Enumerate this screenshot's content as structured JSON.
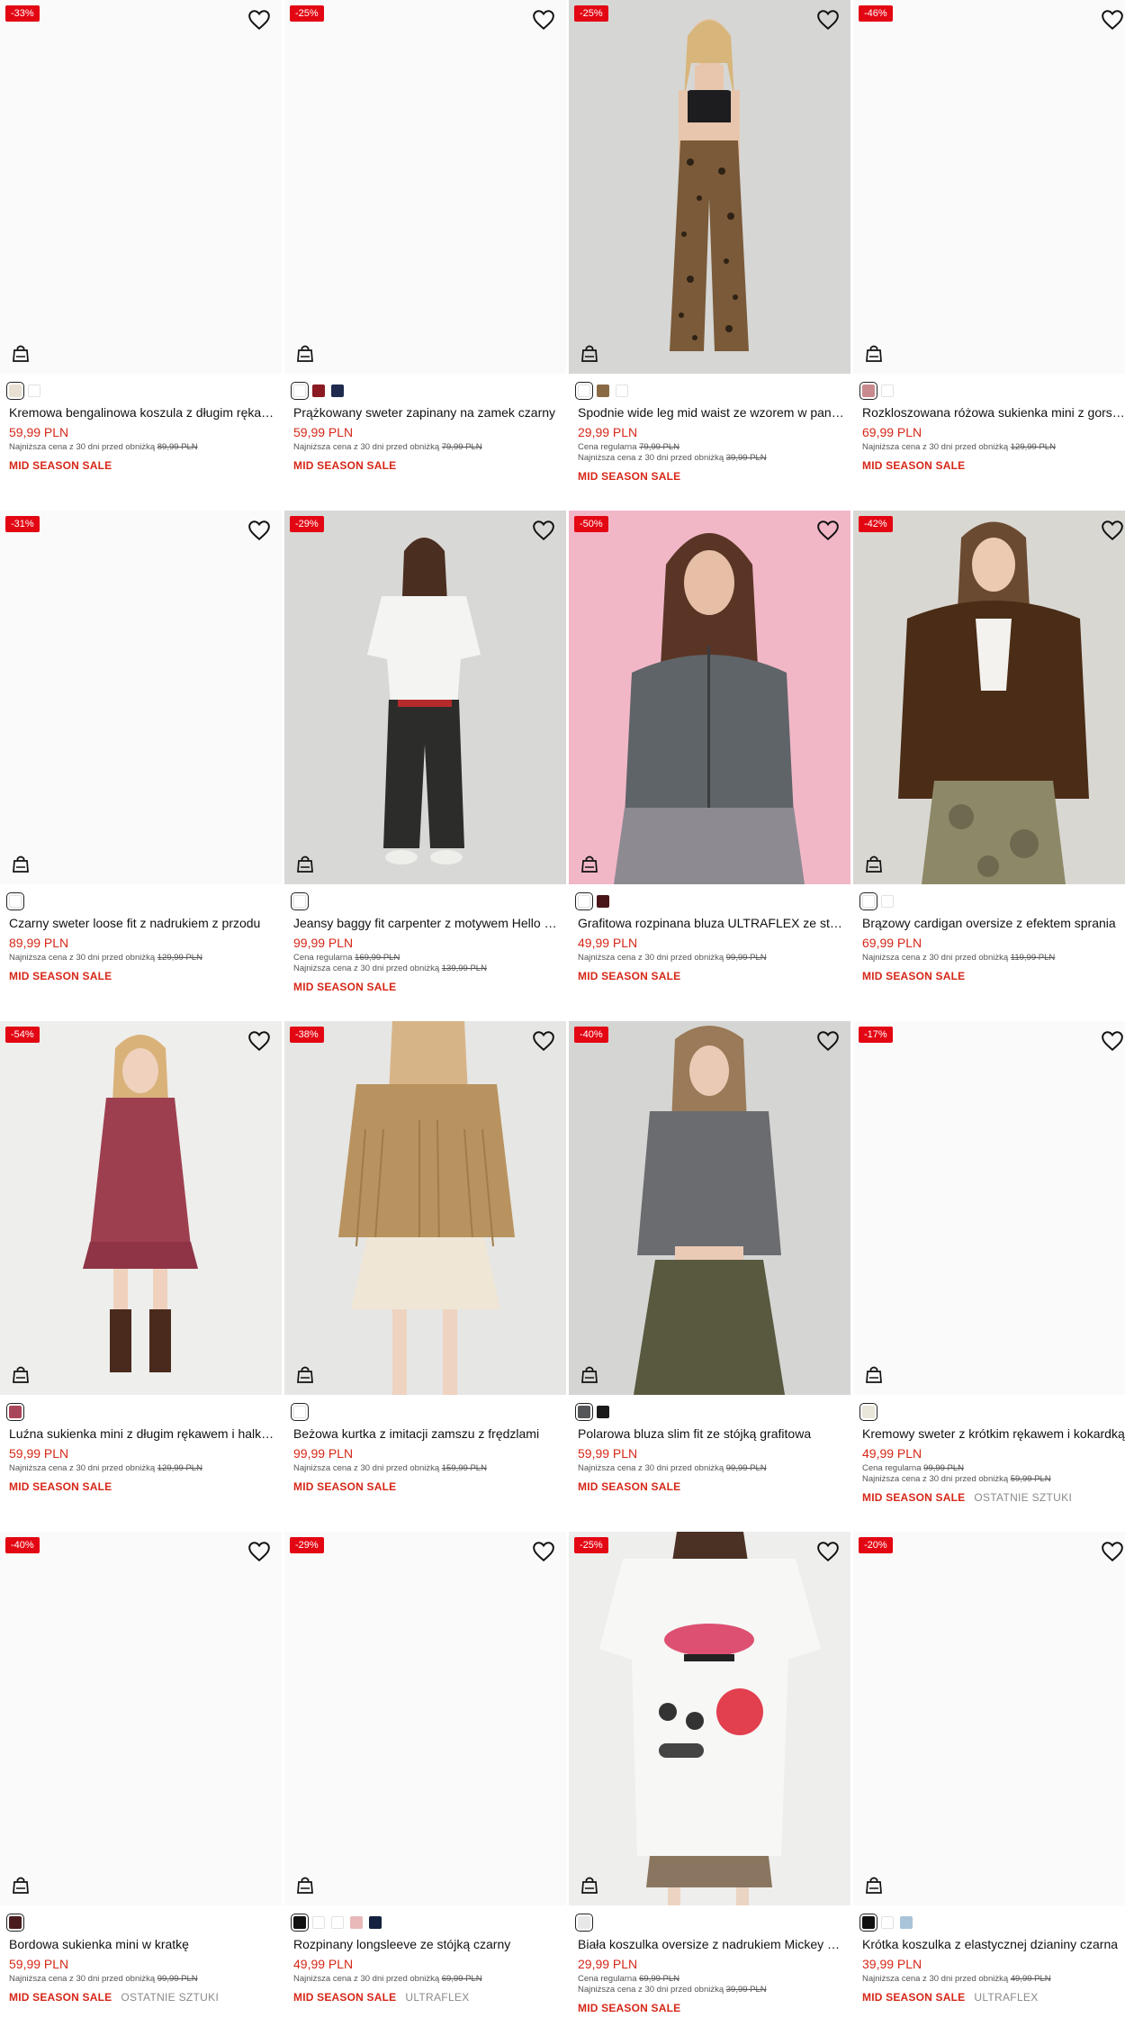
{
  "icons": {
    "wishlist": "heart-icon",
    "cart": "shopping-bag-icon"
  },
  "colors": {
    "discount_badge": "#e30613",
    "price": "#d62718",
    "sale_label": "#d62718"
  },
  "products": [
    {
      "discount": "-33%",
      "name": "Kremowa bengalinowa koszula z długim rękawem i kieszonkami",
      "price": "59,99 PLN",
      "regular_label": "",
      "regular_price": "",
      "lowest_label": "Najniższa cena z 30 dni przed obniżką",
      "lowest_price": "89,99 PLN",
      "sale": "MID SEASON SALE",
      "tag": "",
      "swatches": [
        "#e8e1d3",
        "#ffffff"
      ],
      "photo": "none"
    },
    {
      "discount": "-25%",
      "name": "Prążkowany sweter zapinany na zamek czarny",
      "price": "59,99 PLN",
      "regular_label": "",
      "regular_price": "",
      "lowest_label": "Najniższa cena z 30 dni przed obniżką",
      "lowest_price": "79,99 PLN",
      "sale": "MID SEASON SALE",
      "tag": "",
      "swatches": [
        "#ffffff",
        "#8b1a22",
        "#1f2a4e"
      ],
      "photo": "none"
    },
    {
      "discount": "-25%",
      "name": "Spodnie wide leg mid waist ze wzorem w panterkę",
      "price": "29,99 PLN",
      "regular_label": "Cena regularna",
      "regular_price": "79,99 PLN",
      "lowest_label": "Najniższa cena z 30 dni przed obniżką",
      "lowest_price": "39,99 PLN",
      "sale": "MID SEASON SALE",
      "tag": "",
      "swatches": [
        "#ffffff",
        "#8a6a45",
        "#ffffff"
      ],
      "photo": "leopard"
    },
    {
      "discount": "-46%",
      "name": "Rozkloszowana różowa sukienka mini z gorsetem",
      "price": "69,99 PLN",
      "regular_label": "",
      "regular_price": "",
      "lowest_label": "Najniższa cena z 30 dni przed obniżką",
      "lowest_price": "129,99 PLN",
      "sale": "MID SEASON SALE",
      "tag": "",
      "swatches": [
        "#c98a8e",
        "#ffffff"
      ],
      "photo": "none"
    },
    {
      "discount": "-31%",
      "name": "Czarny sweter loose fit z nadrukiem z przodu",
      "price": "89,99 PLN",
      "regular_label": "",
      "regular_price": "",
      "lowest_label": "Najniższa cena z 30 dni przed obniżką",
      "lowest_price": "129,99 PLN",
      "sale": "MID SEASON SALE",
      "tag": "",
      "swatches": [
        "#ffffff"
      ],
      "photo": "none"
    },
    {
      "discount": "-29%",
      "name": "Jeansy baggy fit carpenter z motywem Hello Kitty",
      "price": "99,99 PLN",
      "regular_label": "Cena regularna",
      "regular_price": "169,99 PLN",
      "lowest_label": "Najniższa cena z 30 dni przed obniżką",
      "lowest_price": "139,99 PLN",
      "sale": "MID SEASON SALE",
      "tag": "",
      "swatches": [
        "#ffffff"
      ],
      "photo": "tee-jeans"
    },
    {
      "discount": "-50%",
      "name": "Grafitowa rozpinana bluza ULTRAFLEX ze stójką",
      "price": "49,99 PLN",
      "regular_label": "",
      "regular_price": "",
      "lowest_label": "Najniższa cena z 30 dni przed obniżką",
      "lowest_price": "99,99 PLN",
      "sale": "MID SEASON SALE",
      "tag": "",
      "swatches": [
        "#ffffff",
        "#4a1518"
      ],
      "photo": "pink-zip"
    },
    {
      "discount": "-42%",
      "name": "Brązowy cardigan oversize z efektem sprania",
      "price": "69,99 PLN",
      "regular_label": "",
      "regular_price": "",
      "lowest_label": "Najniższa cena z 30 dni przed obniżką",
      "lowest_price": "119,99 PLN",
      "sale": "MID SEASON SALE",
      "tag": "",
      "swatches": [
        "#ffffff",
        "#ffffff"
      ],
      "photo": "cardigan"
    },
    {
      "discount": "-54%",
      "name": "Luźna sukienka mini z długim rękawem i halką bordowa",
      "price": "59,99 PLN",
      "regular_label": "",
      "regular_price": "",
      "lowest_label": "Najniższa cena z 30 dni przed obniżką",
      "lowest_price": "129,99 PLN",
      "sale": "MID SEASON SALE",
      "tag": "",
      "swatches": [
        "#a9475a"
      ],
      "photo": "red-dress"
    },
    {
      "discount": "-38%",
      "name": "Beżowa kurtka z imitacji zamszu z frędzlami",
      "price": "99,99 PLN",
      "regular_label": "",
      "regular_price": "",
      "lowest_label": "Najniższa cena z 30 dni przed obniżką",
      "lowest_price": "159,99 PLN",
      "sale": "MID SEASON SALE",
      "tag": "",
      "swatches": [
        "#ffffff"
      ],
      "photo": "fringe"
    },
    {
      "discount": "-40%",
      "name": "Polarowa bluza slim fit ze stójką grafitowa",
      "price": "59,99 PLN",
      "regular_label": "",
      "regular_price": "",
      "lowest_label": "Najniższa cena z 30 dni przed obniżką",
      "lowest_price": "99,99 PLN",
      "sale": "MID SEASON SALE",
      "tag": "",
      "swatches": [
        "#55565a",
        "#1a1a1a"
      ],
      "photo": "grey-fleece"
    },
    {
      "discount": "-17%",
      "name": "Kremowy sweter z krótkim rękawem i kokardką",
      "price": "49,99 PLN",
      "regular_label": "Cena regularna",
      "regular_price": "99,99 PLN",
      "lowest_label": "Najniższa cena z 30 dni przed obniżką",
      "lowest_price": "59,99 PLN",
      "sale": "MID SEASON SALE",
      "tag": "OSTATNIE SZTUKI",
      "swatches": [
        "#e9e6da"
      ],
      "photo": "none"
    },
    {
      "discount": "-40%",
      "name": "Bordowa sukienka mini w kratkę",
      "price": "59,99 PLN",
      "regular_label": "",
      "regular_price": "",
      "lowest_label": "Najniższa cena z 30 dni przed obniżką",
      "lowest_price": "99,99 PLN",
      "sale": "MID SEASON SALE",
      "tag": "OSTATNIE SZTUKI",
      "swatches": [
        "#4a1c1e"
      ],
      "photo": "none"
    },
    {
      "discount": "-29%",
      "name": "Rozpinany longsleeve ze stójką czarny",
      "price": "49,99 PLN",
      "regular_label": "",
      "regular_price": "",
      "lowest_label": "Najniższa cena z 30 dni przed obniżką",
      "lowest_price": "69,99 PLN",
      "sale": "MID SEASON SALE",
      "tag": "ULTRAFLEX",
      "swatches": [
        "#111111",
        "#ffffff",
        "#ffffff",
        "#e9b8b8",
        "#13203f"
      ],
      "photo": "none"
    },
    {
      "discount": "-25%",
      "name": "Biała koszulka oversize z nadrukiem Mickey Mouse",
      "price": "29,99 PLN",
      "regular_label": "Cena regularna",
      "regular_price": "69,99 PLN",
      "lowest_label": "Najniższa cena z 30 dni przed obniżką",
      "lowest_price": "39,99 PLN",
      "sale": "MID SEASON SALE",
      "tag": "",
      "swatches": [
        "#e8e8e8"
      ],
      "photo": "print-tee"
    },
    {
      "discount": "-20%",
      "name": "Krótka koszulka z elastycznej dzianiny czarna",
      "price": "39,99 PLN",
      "regular_label": "",
      "regular_price": "",
      "lowest_label": "Najniższa cena z 30 dni przed obniżką",
      "lowest_price": "49,99 PLN",
      "sale": "MID SEASON SALE",
      "tag": "ULTRAFLEX",
      "swatches": [
        "#111111",
        "#ffffff",
        "#a9c4d8"
      ],
      "photo": "none"
    }
  ]
}
